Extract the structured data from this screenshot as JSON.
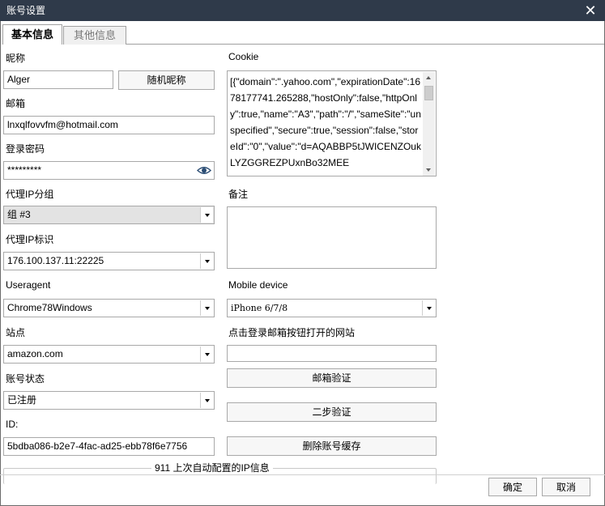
{
  "window": {
    "title": "账号设置",
    "close_glyph": "✕"
  },
  "tabs": {
    "basic": "基本信息",
    "other": "其他信息"
  },
  "nickname": {
    "label": "昵称",
    "value": "Alger",
    "random_button": "随机昵称"
  },
  "email": {
    "label": "邮箱",
    "value": "lnxqlfovvfm@hotmail.com"
  },
  "password": {
    "label": "登录密码",
    "value": "*********"
  },
  "proxy_group": {
    "label": "代理IP分组",
    "value": "组 #3"
  },
  "proxy_id": {
    "label": "代理IP标识",
    "value": "176.100.137.11:22225"
  },
  "useragent": {
    "label": "Useragent",
    "value": "Chrome78Windows"
  },
  "site": {
    "label": "站点",
    "value": "amazon.com"
  },
  "status": {
    "label": "账号状态",
    "value": "已注册"
  },
  "id": {
    "label": "ID:",
    "value": "5bdba086-b2e7-4fac-ad25-ebb78f6e7756"
  },
  "cookie": {
    "label": "Cookie",
    "value": "[{\"domain\":\".yahoo.com\",\"expirationDate\":1678177741.265288,\"hostOnly\":false,\"httpOnly\":true,\"name\":\"A3\",\"path\":\"/\",\"sameSite\":\"unspecified\",\"secure\":true,\"session\":false,\"storeId\":\"0\",\"value\":\"d=AQABBP5tJWICENZOukLYZGGREZPUxnBo32MEE"
  },
  "note": {
    "label": "备注",
    "value": ""
  },
  "mobile_device": {
    "label": "Mobile device",
    "value": "iPhone 6/7/8"
  },
  "login_site": {
    "label": "点击登录邮箱按钮打开的网站",
    "value": ""
  },
  "buttons": {
    "email_verify": "邮箱验证",
    "two_step": "二步验证",
    "clear_cache": "删除账号缓存",
    "ok": "确定",
    "cancel": "取消"
  },
  "ip_info_group": {
    "legend": "911 上次自动配置的IP信息"
  },
  "icons": {
    "password_toggle": "eye-icon",
    "close": "close-icon"
  }
}
